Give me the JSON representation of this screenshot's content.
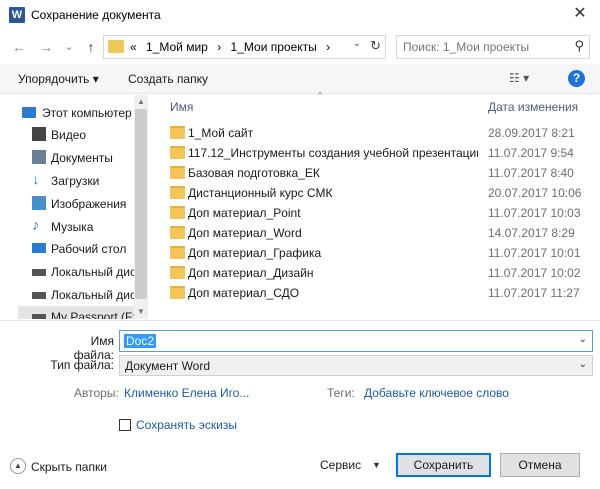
{
  "window": {
    "title": "Сохранение документа",
    "app_icon": "W",
    "close_glyph": "✕"
  },
  "nav": {
    "back_glyph": "←",
    "forward_glyph": "→",
    "recent_glyph": "⌄",
    "up_glyph": "↑",
    "breadcrumb": [
      "«",
      "1_Мой мир",
      "›",
      "1_Мои проекты",
      "›"
    ],
    "address_dropdown": "⌄",
    "refresh_glyph": "↻",
    "search_placeholder": "Поиск: 1_Мои проекты",
    "search_glyph": "⚲"
  },
  "toolbar": {
    "organize": "Упорядочить ▾",
    "new_folder": "Создать папку",
    "view": "☷ ▾",
    "help": "?"
  },
  "sidebar": {
    "items": [
      {
        "label": "Этот компьютер",
        "icon": "computer-icon",
        "color": "#2b7bd0"
      },
      {
        "label": "Видео",
        "icon": "video-icon",
        "color": "#444444"
      },
      {
        "label": "Документы",
        "icon": "documents-icon",
        "color": "#6b7f95"
      },
      {
        "label": "Загрузки",
        "icon": "downloads-icon",
        "color": "#2b7bd0"
      },
      {
        "label": "Изображения",
        "icon": "pictures-icon",
        "color": "#4a8fc7"
      },
      {
        "label": "Музыка",
        "icon": "music-icon",
        "color": "#2b7bd0"
      },
      {
        "label": "Рабочий стол",
        "icon": "desktop-icon",
        "color": "#2b7bd0"
      },
      {
        "label": "Локальный дис",
        "icon": "drive-icon",
        "color": "#555555"
      },
      {
        "label": "Локальный дис",
        "icon": "drive-icon",
        "color": "#555555"
      },
      {
        "label": "My Passport (F:)",
        "icon": "external-drive-icon",
        "color": "#555555"
      }
    ]
  },
  "files": {
    "columns": {
      "name": "Имя",
      "date": "Дата изменения"
    },
    "sort_glyph": "^",
    "rows": [
      {
        "name": "1_Мой сайт",
        "date": "28.09.2017 8:21"
      },
      {
        "name": "117.12_Инструменты создания учебной презентации ...",
        "date": "11.07.2017 9:54"
      },
      {
        "name": "Базовая подготовка_ЕК",
        "date": "11.07.2017 8:40"
      },
      {
        "name": "Дистанционный курс СМК",
        "date": "20.07.2017 10:06"
      },
      {
        "name": "Доп материал_Point",
        "date": "11.07.2017 10:03"
      },
      {
        "name": "Доп материал_Word",
        "date": "14.07.2017 8:29"
      },
      {
        "name": "Доп материал_Графика",
        "date": "11.07.2017 10:01"
      },
      {
        "name": "Доп материал_Дизайн",
        "date": "11.07.2017 10:02"
      },
      {
        "name": "Доп материал_СДО",
        "date": "11.07.2017 11:27"
      }
    ]
  },
  "form": {
    "filename_label": "Имя файла:",
    "filename_value": "Doc2",
    "filetype_label": "Тип файла:",
    "filetype_value": "Документ Word",
    "authors_label": "Авторы:",
    "authors_value": "Клименко Елена Иго...",
    "tags_label": "Теги:",
    "tags_value": "Добавьте ключевое слово",
    "thumbnails_label": "Сохранять эскизы",
    "dropdown_glyph": "⌄"
  },
  "footer": {
    "hide_folders": "Скрыть папки",
    "hide_glyph": "▲",
    "service": "Сервис",
    "service_glyph": "▼",
    "save": "Сохранить",
    "cancel": "Отмена"
  },
  "colors": {
    "accent": "#0078d7",
    "link": "#1e5aa8",
    "selection": "#3399ff",
    "folder": "#f5c55c"
  }
}
